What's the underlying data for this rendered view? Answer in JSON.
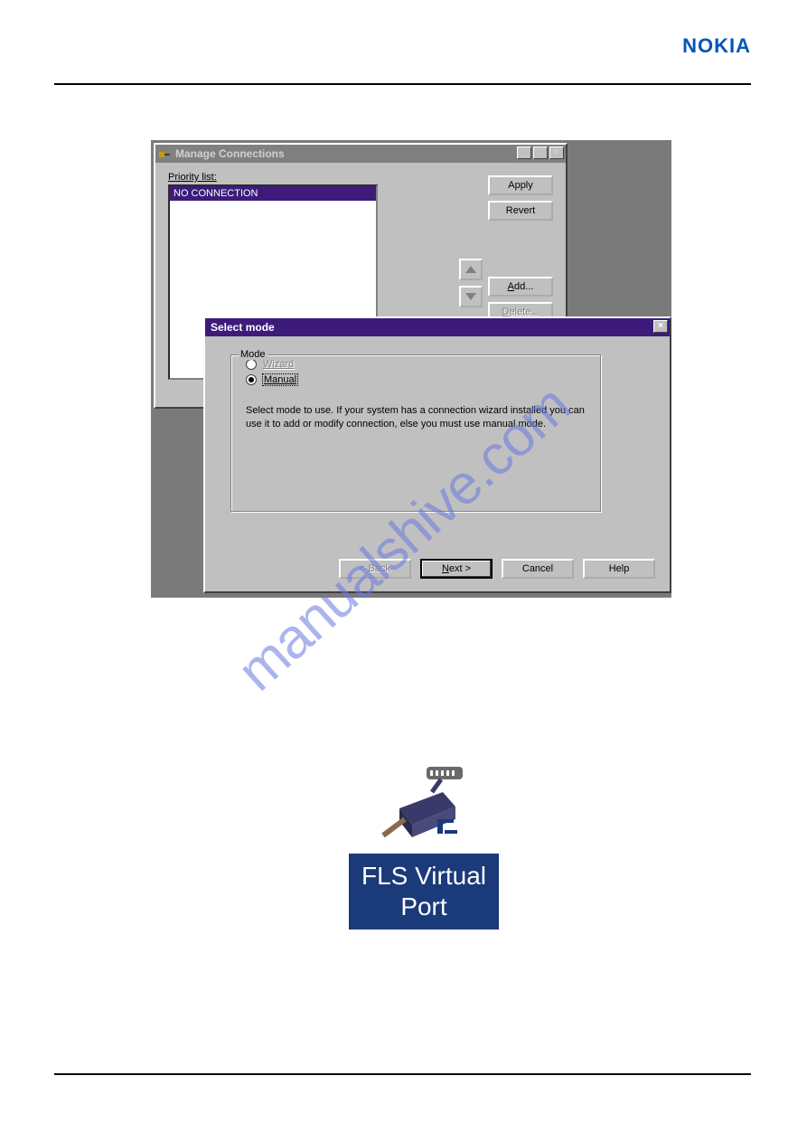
{
  "header": {
    "brand": "NOKIA"
  },
  "watermark": "manualshive.com",
  "manage_connections": {
    "title": "Manage Connections",
    "priority_label_pre": "P",
    "priority_label_u": "r",
    "priority_label_post": "iority list:",
    "list_item": "NO CONNECTION",
    "apply": "Apply",
    "revert": "Revert",
    "add_u": "A",
    "add_rest": "dd...",
    "delete_u": "D",
    "delete_rest": "elete..."
  },
  "select_mode": {
    "title": "Select mode",
    "legend": "Mode",
    "wizard_u": "W",
    "wizard_rest": "izard",
    "manual_u": "M",
    "manual_rest": "anual",
    "desc": "Select mode to use. If your system has a connection wizard installed you can use it to add or modify connection, else you must use manual mode.",
    "back": "< Back",
    "next_u": "N",
    "next_rest": "ext >",
    "cancel": "Cancel",
    "help": "Help"
  },
  "fls": {
    "line1": "FLS Virtual",
    "line2": "Port"
  }
}
